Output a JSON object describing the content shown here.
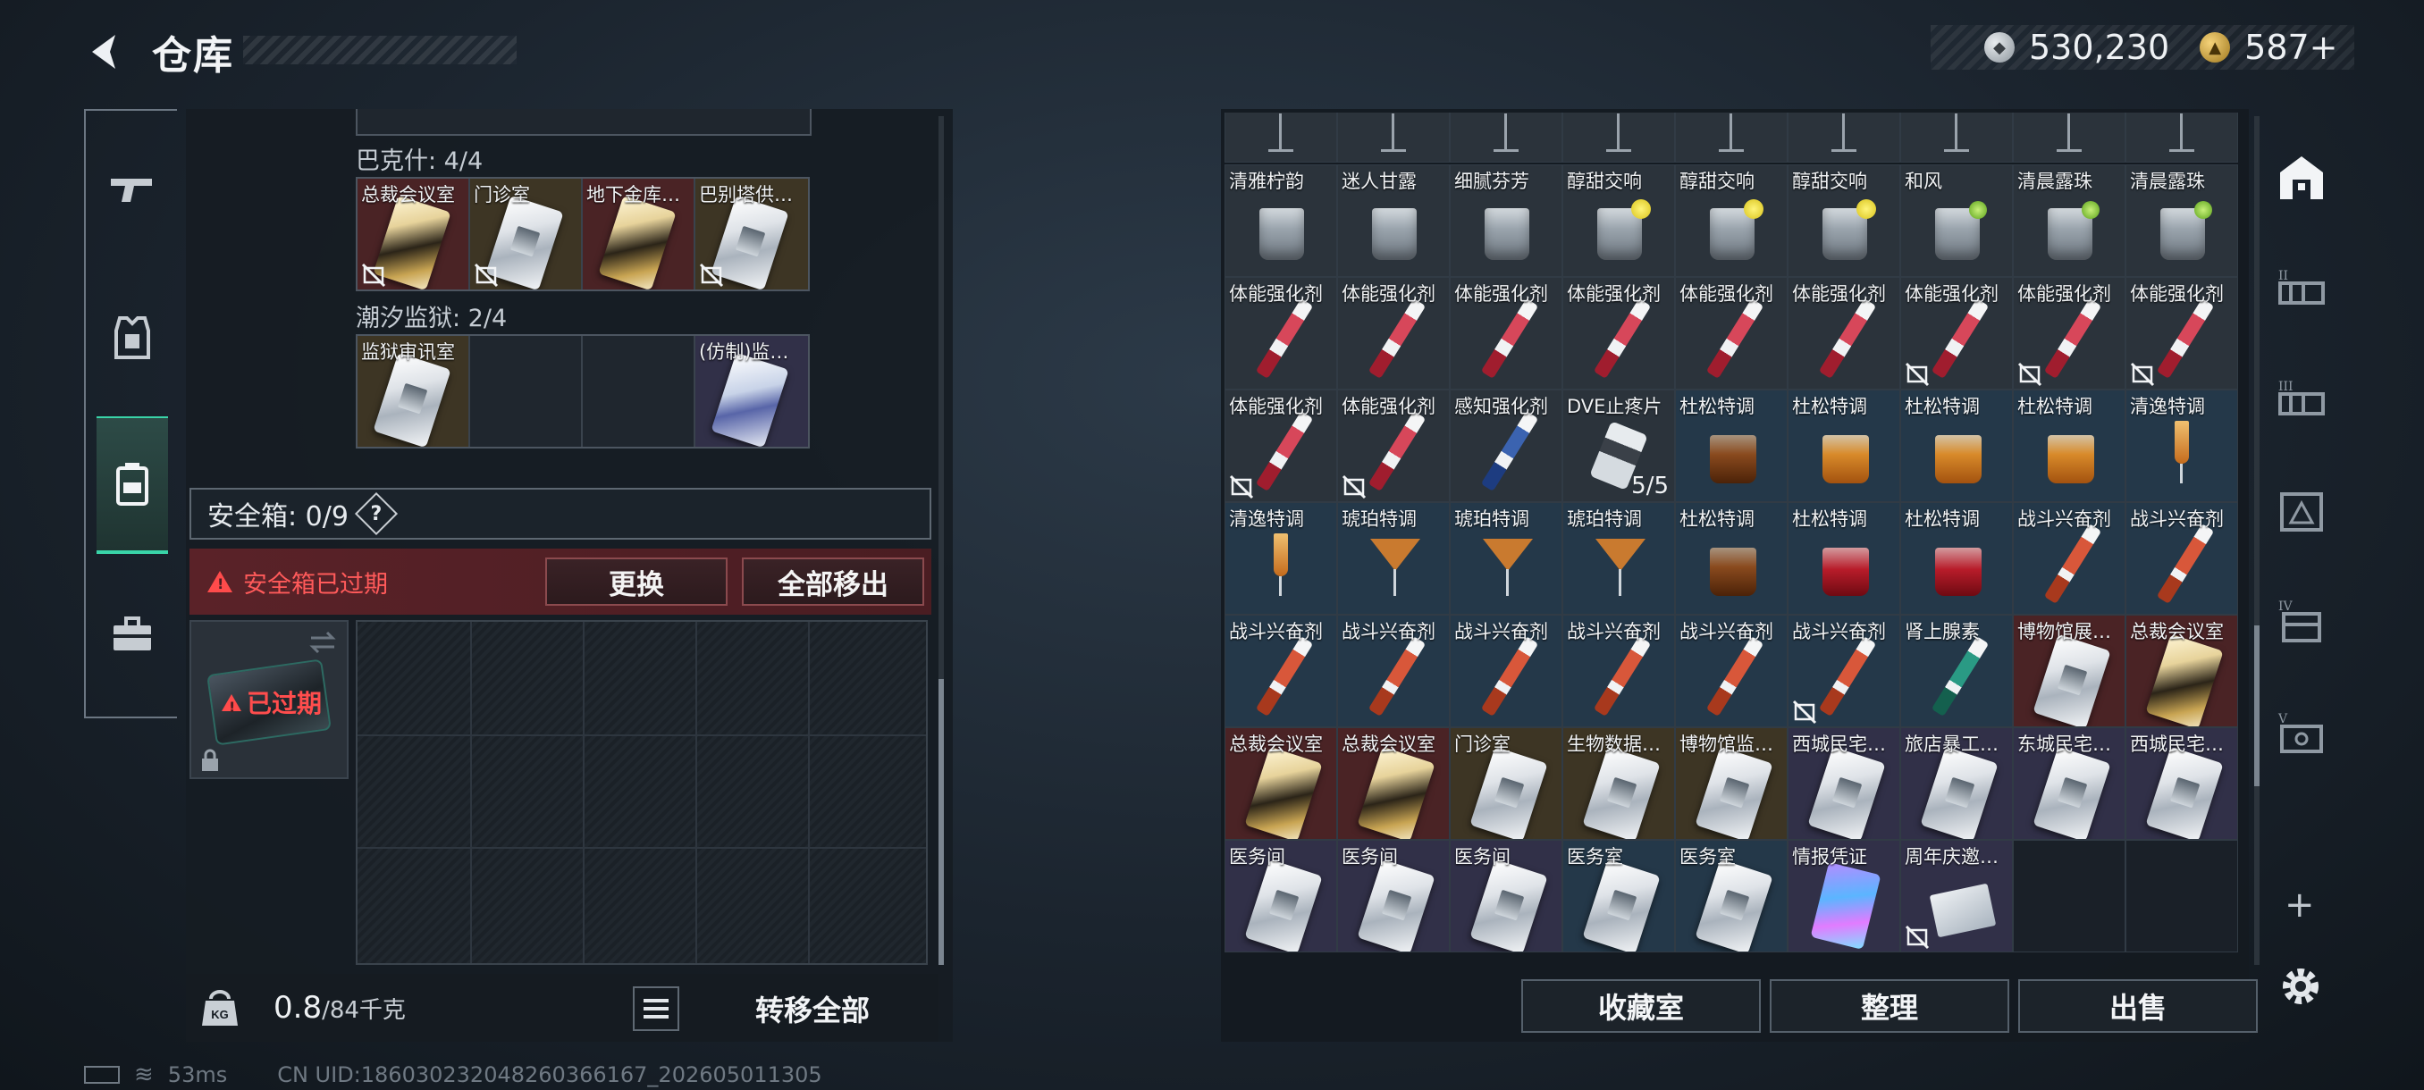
{
  "header": {
    "title": "仓库",
    "currency": {
      "silver": "530,230",
      "gold": "587+"
    }
  },
  "left_nav": [
    "weapons",
    "armor",
    "backpack",
    "case"
  ],
  "left_panel": {
    "groups": [
      {
        "label": "巴克什: 4/4",
        "slots": [
          {
            "name": "总裁会议室",
            "tier": "red",
            "card": "gold",
            "noexit": true
          },
          {
            "name": "门诊室",
            "tier": "gold",
            "card": "silver",
            "noexit": true
          },
          {
            "name": "地下金库…",
            "tier": "red",
            "card": "gold",
            "noexit": false
          },
          {
            "name": "巴别塔供…",
            "tier": "gold",
            "card": "silver",
            "noexit": true
          }
        ]
      },
      {
        "label": "潮汐监狱: 2/4",
        "slots": [
          {
            "name": "监狱审讯室",
            "tier": "gold",
            "card": "silver",
            "noexit": false
          },
          {
            "name": "",
            "tier": "empty",
            "card": "",
            "noexit": false
          },
          {
            "name": "",
            "tier": "empty",
            "card": "",
            "noexit": false
          },
          {
            "name": "(仿制)监…",
            "tier": "purple",
            "card": "blue",
            "noexit": false
          }
        ]
      }
    ],
    "safebox_label": "安全箱: 0/9",
    "help": "?",
    "expired_warning": "安全箱已过期",
    "replace_btn": "更换",
    "remove_all_btn": "全部移出",
    "case_status": "已过期",
    "weight_value": "0.8",
    "weight_max": "/84千克",
    "weight_icon": "KG",
    "transfer_all": "转移全部"
  },
  "status": {
    "ping": "53ms",
    "uid": "CN UID:1860302320482603661​67_202605011305"
  },
  "inventory": {
    "rows": [
      [
        {
          "name": "清雅柠韵",
          "bg": "gray",
          "icon": "glass"
        },
        {
          "name": "迷人甘露",
          "bg": "gray",
          "icon": "glass"
        },
        {
          "name": "细腻芬芳",
          "bg": "gray",
          "icon": "glass"
        },
        {
          "name": "醇甜交响",
          "bg": "gray",
          "icon": "glass-lemon"
        },
        {
          "name": "醇甜交响",
          "bg": "gray",
          "icon": "glass-lemon"
        },
        {
          "name": "醇甜交响",
          "bg": "gray",
          "icon": "glass-lemon"
        },
        {
          "name": "和风",
          "bg": "gray",
          "icon": "glass-lime"
        },
        {
          "name": "清晨露珠",
          "bg": "gray",
          "icon": "glass-lime"
        },
        {
          "name": "清晨露珠",
          "bg": "gray",
          "icon": "glass-lime"
        }
      ],
      [
        {
          "name": "体能强化剂",
          "bg": "gray",
          "icon": "syringe-red"
        },
        {
          "name": "体能强化剂",
          "bg": "gray",
          "icon": "syringe-red"
        },
        {
          "name": "体能强化剂",
          "bg": "gray",
          "icon": "syringe-red"
        },
        {
          "name": "体能强化剂",
          "bg": "gray",
          "icon": "syringe-red"
        },
        {
          "name": "体能强化剂",
          "bg": "gray",
          "icon": "syringe-red"
        },
        {
          "name": "体能强化剂",
          "bg": "gray",
          "icon": "syringe-red"
        },
        {
          "name": "体能强化剂",
          "bg": "gray",
          "icon": "syringe-red",
          "noexit": true
        },
        {
          "name": "体能强化剂",
          "bg": "gray",
          "icon": "syringe-red",
          "noexit": true
        },
        {
          "name": "体能强化剂",
          "bg": "gray",
          "icon": "syringe-red",
          "noexit": true
        }
      ],
      [
        {
          "name": "体能强化剂",
          "bg": "gray",
          "icon": "syringe-red",
          "noexit": true
        },
        {
          "name": "体能强化剂",
          "bg": "gray",
          "icon": "syringe-red",
          "noexit": true
        },
        {
          "name": "感知强化剂",
          "bg": "gray",
          "icon": "syringe-blue"
        },
        {
          "name": "DVE止疼片",
          "bg": "gray",
          "icon": "pills",
          "count": "5/5"
        },
        {
          "name": "杜松特调",
          "bg": "blue",
          "icon": "whisky-dark"
        },
        {
          "name": "杜松特调",
          "bg": "blue",
          "icon": "whisky"
        },
        {
          "name": "杜松特调",
          "bg": "blue",
          "icon": "whisky"
        },
        {
          "name": "杜松特调",
          "bg": "blue",
          "icon": "whisky"
        },
        {
          "name": "清逸特调",
          "bg": "blue",
          "icon": "flute"
        }
      ],
      [
        {
          "name": "清逸特调",
          "bg": "blue",
          "icon": "flute"
        },
        {
          "name": "琥珀特调",
          "bg": "blue",
          "icon": "martini"
        },
        {
          "name": "琥珀特调",
          "bg": "blue",
          "icon": "martini"
        },
        {
          "name": "琥珀特调",
          "bg": "blue",
          "icon": "martini"
        },
        {
          "name": "杜松特调",
          "bg": "blue",
          "icon": "whisky-dark"
        },
        {
          "name": "杜松特调",
          "bg": "blue",
          "icon": "whisky-red"
        },
        {
          "name": "杜松特调",
          "bg": "blue",
          "icon": "whisky-red"
        },
        {
          "name": "战斗兴奋剂",
          "bg": "blue",
          "icon": "syringe-orange"
        },
        {
          "name": "战斗兴奋剂",
          "bg": "blue",
          "icon": "syringe-orange"
        }
      ],
      [
        {
          "name": "战斗兴奋剂",
          "bg": "blue",
          "icon": "syringe-orange"
        },
        {
          "name": "战斗兴奋剂",
          "bg": "blue",
          "icon": "syringe-orange"
        },
        {
          "name": "战斗兴奋剂",
          "bg": "blue",
          "icon": "syringe-orange"
        },
        {
          "name": "战斗兴奋剂",
          "bg": "blue",
          "icon": "syringe-orange"
        },
        {
          "name": "战斗兴奋剂",
          "bg": "blue",
          "icon": "syringe-orange"
        },
        {
          "name": "战斗兴奋剂",
          "bg": "blue",
          "icon": "syringe-orange",
          "noexit": true
        },
        {
          "name": "肾上腺素",
          "bg": "blue",
          "icon": "syringe-green"
        },
        {
          "name": "博物馆展…",
          "bg": "red",
          "icon": "card-silver"
        },
        {
          "name": "总裁会议室",
          "bg": "red",
          "icon": "card-gold"
        }
      ],
      [
        {
          "name": "总裁会议室",
          "bg": "red",
          "icon": "card-gold"
        },
        {
          "name": "总裁会议室",
          "bg": "red",
          "icon": "card-gold"
        },
        {
          "name": "门诊室",
          "bg": "gold",
          "icon": "card-silver"
        },
        {
          "name": "生物数据…",
          "bg": "gold",
          "icon": "card-silver"
        },
        {
          "name": "博物馆监…",
          "bg": "gold",
          "icon": "card-silver"
        },
        {
          "name": "西城民宅…",
          "bg": "purple",
          "icon": "card-silver"
        },
        {
          "name": "旅店暴工…",
          "bg": "purple",
          "icon": "card-silver"
        },
        {
          "name": "东城民宅…",
          "bg": "purple",
          "icon": "card-silver"
        },
        {
          "name": "西城民宅…",
          "bg": "purple",
          "icon": "card-silver"
        }
      ],
      [
        {
          "name": "医务间",
          "bg": "purple",
          "icon": "card-silver"
        },
        {
          "name": "医务间",
          "bg": "purple",
          "icon": "card-silver"
        },
        {
          "name": "医务间",
          "bg": "purple",
          "icon": "card-silver"
        },
        {
          "name": "医务室",
          "bg": "blue",
          "icon": "card-silver"
        },
        {
          "name": "医务室",
          "bg": "blue",
          "icon": "card-silver"
        },
        {
          "name": "情报凭证",
          "bg": "purple",
          "icon": "holo"
        },
        {
          "name": "周年庆邀…",
          "bg": "purple",
          "icon": "doc",
          "noexit": true
        },
        {
          "name": "",
          "bg": "empty",
          "icon": ""
        },
        {
          "name": "",
          "bg": "empty",
          "icon": ""
        }
      ]
    ]
  },
  "right_nav": [
    "main-storage",
    "storage-II",
    "storage-III",
    "storage-IV",
    "storage-IV-b",
    "storage-V"
  ],
  "bottom_buttons": {
    "collection": "收藏室",
    "organize": "整理",
    "sell": "出售"
  },
  "colors": {
    "accent": "#39d4a8",
    "warn": "#ff4b4b",
    "panel": "#1a2028"
  }
}
